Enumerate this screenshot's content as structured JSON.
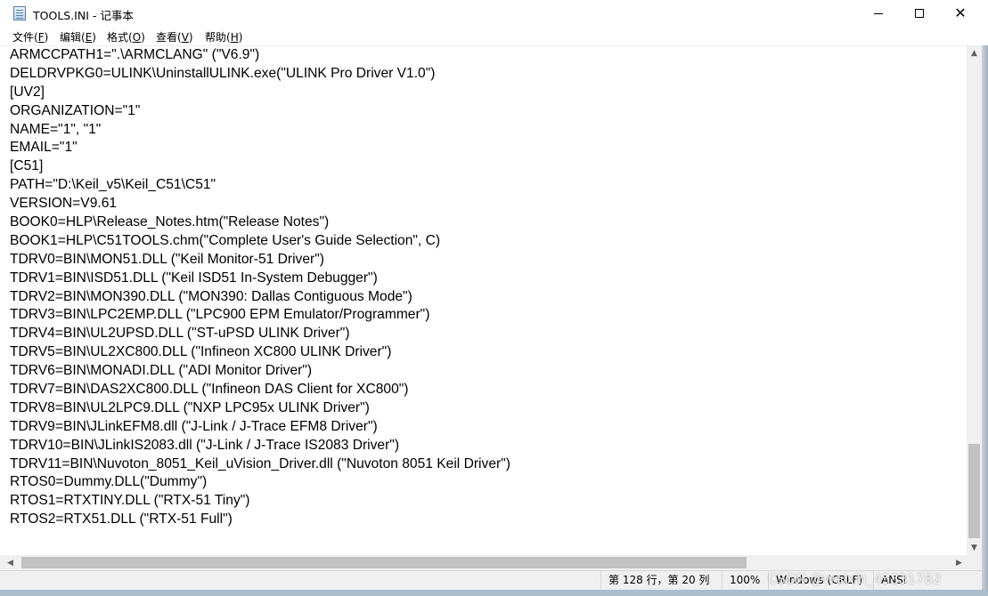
{
  "window": {
    "title": "TOOLS.INI - 记事本",
    "minimize_label": "—",
    "maximize_label": "☐",
    "close_label": "✕"
  },
  "menu": {
    "items": [
      {
        "label": "文件(",
        "key": "F",
        "tail": ")"
      },
      {
        "label": "编辑(",
        "key": "E",
        "tail": ")"
      },
      {
        "label": "格式(",
        "key": "O",
        "tail": ")"
      },
      {
        "label": "查看(",
        "key": "V",
        "tail": ")"
      },
      {
        "label": "帮助(",
        "key": "H",
        "tail": ")"
      }
    ]
  },
  "editor": {
    "lines": [
      "ARMCCPATH1=\".\\ARMCLANG\" (\"V6.9\")",
      "DELDRVPKG0=ULINK\\UninstallULINK.exe(\"ULINK Pro Driver V1.0\")",
      "[UV2]",
      "ORGANIZATION=\"1\"",
      "NAME=\"1\", \"1\"",
      "EMAIL=\"1\"",
      "[C51]",
      "PATH=\"D:\\Keil_v5\\Keil_C51\\C51\"",
      "VERSION=V9.61",
      "BOOK0=HLP\\Release_Notes.htm(\"Release Notes\")",
      "BOOK1=HLP\\C51TOOLS.chm(\"Complete User's Guide Selection\", C)",
      "TDRV0=BIN\\MON51.DLL (\"Keil Monitor-51 Driver\")",
      "TDRV1=BIN\\ISD51.DLL (\"Keil ISD51 In-System Debugger\")",
      "TDRV2=BIN\\MON390.DLL (\"MON390: Dallas Contiguous Mode\")",
      "TDRV3=BIN\\LPC2EMP.DLL (\"LPC900 EPM Emulator/Programmer\")",
      "TDRV4=BIN\\UL2UPSD.DLL (\"ST-uPSD ULINK Driver\")",
      "TDRV5=BIN\\UL2XC800.DLL (\"Infineon XC800 ULINK Driver\")",
      "TDRV6=BIN\\MONADI.DLL (\"ADI Monitor Driver\")",
      "TDRV7=BIN\\DAS2XC800.DLL (\"Infineon DAS Client for XC800\")",
      "TDRV8=BIN\\UL2LPC9.DLL (\"NXP LPC95x ULINK Driver\")",
      "TDRV9=BIN\\JLinkEFM8.dll (\"J-Link / J-Trace EFM8 Driver\")",
      "TDRV10=BIN\\JLinkIS2083.dll (\"J-Link / J-Trace IS2083 Driver\")",
      "TDRV11=BIN\\Nuvoton_8051_Keil_uVision_Driver.dll (\"Nuvoton 8051 Keil Driver\")",
      "RTOS0=Dummy.DLL(\"Dummy\")",
      "RTOS1=RTXTINY.DLL (\"RTX-51 Tiny\")",
      "RTOS2=RTX51.DLL (\"RTX-51 Full\")"
    ]
  },
  "statusbar": {
    "position": "第 128 行，第 20 列",
    "zoom": "100%",
    "line_ending": "Windows (CRLF)",
    "encoding": "ANSI"
  },
  "watermark": "CSDN @weixin_45831782",
  "colors": {
    "scrollbar_track": "#f0f0f0",
    "scrollbar_thumb": "#c1c1c1",
    "statusbar_bg": "#f0f0f0"
  }
}
